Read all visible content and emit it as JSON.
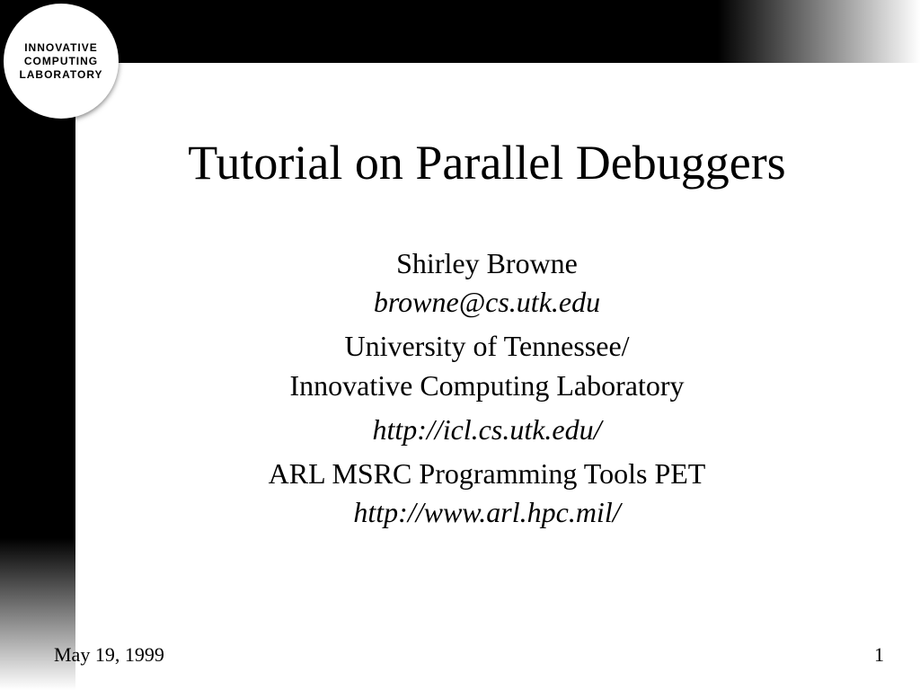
{
  "logo": {
    "line1": "INNOVATIVE",
    "line2": "COMPUTING",
    "line3": "LABORATORY"
  },
  "title": "Tutorial on Parallel Debuggers",
  "author": "Shirley Browne",
  "email": "browne@cs.utk.edu",
  "affiliation_line1": "University of Tennessee/",
  "affiliation_line2": "Innovative Computing Laboratory",
  "url1": "http://icl.cs.utk.edu/",
  "program": "ARL MSRC Programming Tools PET",
  "url2": "http://www.arl.hpc.mil/",
  "footer": {
    "date": "May 19, 1999",
    "page": "1"
  }
}
